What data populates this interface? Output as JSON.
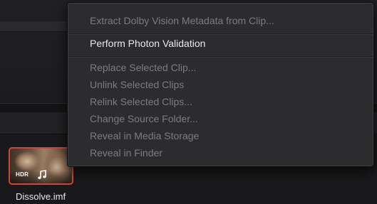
{
  "context_menu": {
    "items": [
      {
        "label": "Extract Dolby Vision Metadata from Clip...",
        "enabled": false
      },
      {
        "label": "Perform Photon Validation",
        "enabled": true
      },
      {
        "label": "Replace Selected Clip...",
        "enabled": false
      },
      {
        "label": "Unlink Selected Clips",
        "enabled": false
      },
      {
        "label": "Relink Selected Clips...",
        "enabled": false
      },
      {
        "label": "Change Source Folder...",
        "enabled": false
      },
      {
        "label": "Reveal in Media Storage",
        "enabled": false
      },
      {
        "label": "Reveal in Finder",
        "enabled": false
      }
    ]
  },
  "clip": {
    "name": "Dissolve.imf",
    "badge": "HDR",
    "audio_icon": "music-note-icon",
    "selected_border_color": "#d0453a"
  },
  "colors": {
    "menu_background": "#2c2c2f",
    "enabled_text": "#e9e9eb",
    "disabled_text": "#7c7c80"
  }
}
